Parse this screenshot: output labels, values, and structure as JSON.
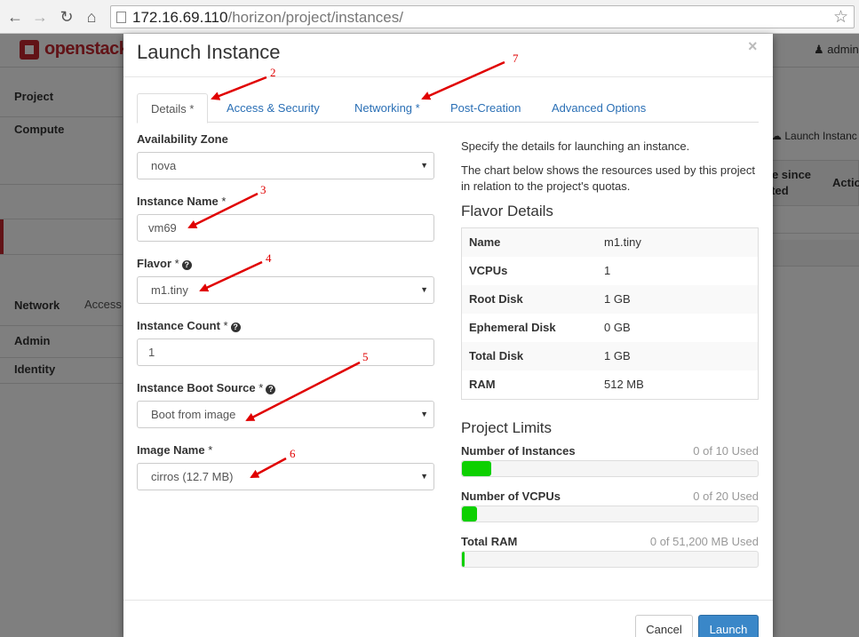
{
  "browser": {
    "url_host": "172.16.69.110",
    "url_path": "/horizon/project/instances/"
  },
  "app": {
    "brand": "openstack",
    "user": "admin",
    "sidebar": {
      "project": "Project",
      "compute": "Compute",
      "access": "Access",
      "network": "Network",
      "admin": "Admin",
      "identity": "Identity"
    },
    "page": {
      "launch_button": "Launch Instanc",
      "col_time_since_1": "ne since",
      "col_time_since_2": "ated",
      "col_actions": "Actio"
    }
  },
  "modal": {
    "title": "Launch Instance",
    "close": "×",
    "tabs": [
      {
        "label": "Details *"
      },
      {
        "label": "Access & Security"
      },
      {
        "label": "Networking *"
      },
      {
        "label": "Post-Creation"
      },
      {
        "label": "Advanced Options"
      }
    ],
    "fields": {
      "availability_zone": {
        "label": "Availability Zone",
        "value": "nova"
      },
      "instance_name": {
        "label": "Instance Name",
        "value": "vm69"
      },
      "flavor": {
        "label": "Flavor",
        "value": "m1.tiny"
      },
      "instance_count": {
        "label": "Instance Count",
        "value": "1"
      },
      "boot_source": {
        "label": "Instance Boot Source",
        "value": "Boot from image"
      },
      "image_name": {
        "label": "Image Name",
        "value": "cirros (12.7 MB)"
      }
    },
    "required_mark": "*",
    "help_mark": "?",
    "description_1": "Specify the details for launching an instance.",
    "description_2": "The chart below shows the resources used by this project in relation to the project's quotas.",
    "flavor_details": {
      "title": "Flavor Details",
      "rows": [
        {
          "key": "Name",
          "value": "m1.tiny"
        },
        {
          "key": "VCPUs",
          "value": "1"
        },
        {
          "key": "Root Disk",
          "value": "1 GB"
        },
        {
          "key": "Ephemeral Disk",
          "value": "0 GB"
        },
        {
          "key": "Total Disk",
          "value": "1 GB"
        },
        {
          "key": "RAM",
          "value": "512 MB"
        }
      ]
    },
    "project_limits": {
      "title": "Project Limits",
      "instances": {
        "label": "Number of Instances",
        "used": "0 of 10 Used",
        "fraction": 0.1
      },
      "vcpus": {
        "label": "Number of VCPUs",
        "used": "0 of 20 Used",
        "fraction": 0.05
      },
      "ram": {
        "label": "Total RAM",
        "used": "0 of 51,200 MB Used",
        "fraction": 0.01
      }
    },
    "buttons": {
      "cancel": "Cancel",
      "launch": "Launch"
    }
  },
  "annotations": [
    "2",
    "3",
    "4",
    "5",
    "6",
    "7"
  ],
  "colors": {
    "annotation": "#e00000",
    "quota_bar": "#0dd000",
    "brand": "#c4262e",
    "primary": "#3a87c8"
  }
}
